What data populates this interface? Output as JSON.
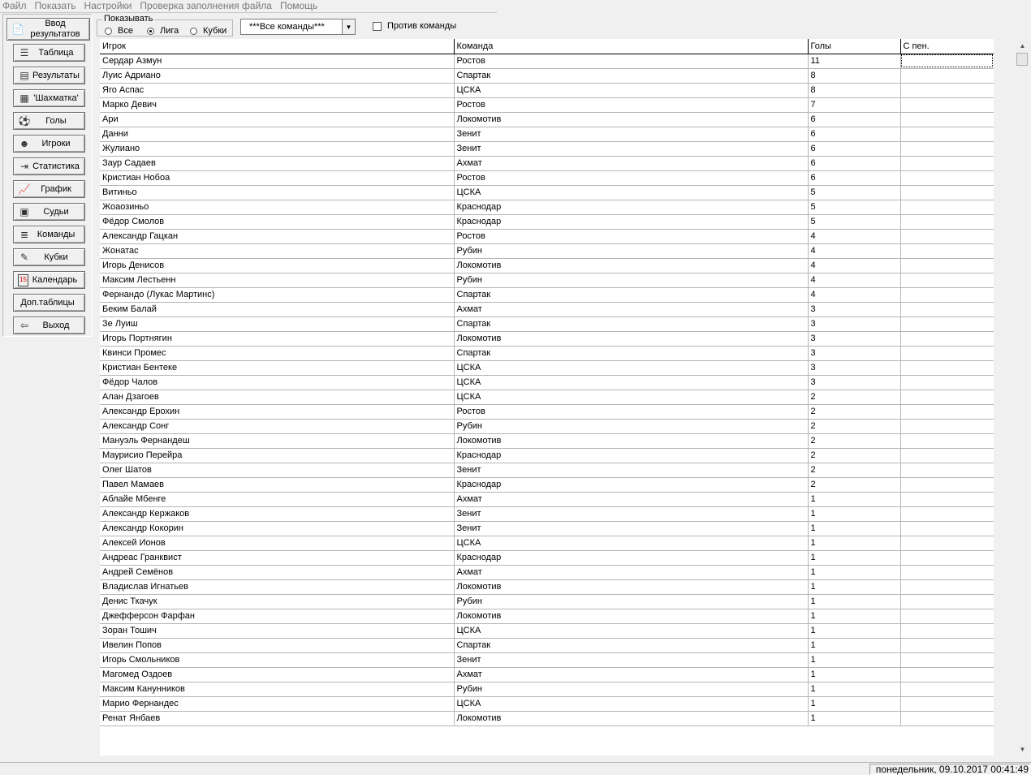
{
  "menu": [
    "Файл",
    "Показать",
    "Настройки",
    "Проверка заполнения файла",
    "Помощь"
  ],
  "nav": [
    {
      "label": "Ввод результатов",
      "icon": "📄"
    },
    {
      "label": "Таблица",
      "icon": "☰"
    },
    {
      "label": "Результаты",
      "icon": "▤"
    },
    {
      "label": "'Шахматка'",
      "icon": "▦"
    },
    {
      "label": "Голы",
      "icon": "⚽"
    },
    {
      "label": "Игроки",
      "icon": "☻"
    },
    {
      "label": "Статистика",
      "icon": "⇥"
    },
    {
      "label": "График",
      "icon": "📈"
    },
    {
      "label": "Судьи",
      "icon": "▣"
    },
    {
      "label": "Команды",
      "icon": "≣"
    },
    {
      "label": "Кубки",
      "icon": "✎"
    },
    {
      "label": "Календарь",
      "icon": "15"
    },
    {
      "label": "Доп.таблицы",
      "icon": ""
    },
    {
      "label": "Выход",
      "icon": "⇦"
    }
  ],
  "filter": {
    "legend": "Показывать",
    "options": [
      "Все",
      "Лига",
      "Кубки"
    ],
    "selected": "Лига"
  },
  "team_select": {
    "value": "***Все команды***"
  },
  "against_checkbox": {
    "label": "Против команды",
    "checked": false
  },
  "grid": {
    "columns": [
      "Игрок",
      "Команда",
      "Голы",
      "С пен."
    ],
    "rows": [
      [
        "Сердар Азмун",
        "Ростов",
        "11",
        ""
      ],
      [
        "Луис Адриано",
        "Спартак",
        "8",
        ""
      ],
      [
        "Яго Аспас",
        "ЦСКА",
        "8",
        ""
      ],
      [
        "Марко Девич",
        "Ростов",
        "7",
        ""
      ],
      [
        "Ари",
        "Локомотив",
        "6",
        ""
      ],
      [
        "Данни",
        "Зенит",
        "6",
        ""
      ],
      [
        "Жулиано",
        "Зенит",
        "6",
        ""
      ],
      [
        "Заур Садаев",
        "Ахмат",
        "6",
        ""
      ],
      [
        "Кристиан Нобоа",
        "Ростов",
        "6",
        ""
      ],
      [
        "Витиньо",
        "ЦСКА",
        "5",
        ""
      ],
      [
        "Жоаозиньо",
        "Краснодар",
        "5",
        ""
      ],
      [
        "Фёдор Смолов",
        "Краснодар",
        "5",
        ""
      ],
      [
        "Александр Гацкан",
        "Ростов",
        "4",
        ""
      ],
      [
        "Жонатас",
        "Рубин",
        "4",
        ""
      ],
      [
        "Игорь Денисов",
        "Локомотив",
        "4",
        ""
      ],
      [
        "Максим Лестьенн",
        "Рубин",
        "4",
        ""
      ],
      [
        "Фернандо (Лукас Мартинс)",
        "Спартак",
        "4",
        ""
      ],
      [
        "Беким Балай",
        "Ахмат",
        "3",
        ""
      ],
      [
        "Зе Луиш",
        "Спартак",
        "3",
        ""
      ],
      [
        "Игорь Портнягин",
        "Локомотив",
        "3",
        ""
      ],
      [
        "Квинси Промес",
        "Спартак",
        "3",
        ""
      ],
      [
        "Кристиан Бентеке",
        "ЦСКА",
        "3",
        ""
      ],
      [
        "Фёдор Чалов",
        "ЦСКА",
        "3",
        ""
      ],
      [
        "Алан Дзагоев",
        "ЦСКА",
        "2",
        ""
      ],
      [
        "Александр Ерохин",
        "Ростов",
        "2",
        ""
      ],
      [
        "Александр Сонг",
        "Рубин",
        "2",
        ""
      ],
      [
        "Мануэль Фернандеш",
        "Локомотив",
        "2",
        ""
      ],
      [
        "Маурисио Перейра",
        "Краснодар",
        "2",
        ""
      ],
      [
        "Олег Шатов",
        "Зенит",
        "2",
        ""
      ],
      [
        "Павел Мамаев",
        "Краснодар",
        "2",
        ""
      ],
      [
        "Аблайе Мбенге",
        "Ахмат",
        "1",
        ""
      ],
      [
        "Александр Кержаков",
        "Зенит",
        "1",
        ""
      ],
      [
        "Александр Кокорин",
        "Зенит",
        "1",
        ""
      ],
      [
        "Алексей Ионов",
        "ЦСКА",
        "1",
        ""
      ],
      [
        "Андреас Гранквист",
        "Краснодар",
        "1",
        ""
      ],
      [
        "Андрей Семёнов",
        "Ахмат",
        "1",
        ""
      ],
      [
        "Владислав Игнатьев",
        "Локомотив",
        "1",
        ""
      ],
      [
        "Денис Ткачук",
        "Рубин",
        "1",
        ""
      ],
      [
        "Джефферсон Фарфан",
        "Локомотив",
        "1",
        ""
      ],
      [
        "Зоран Тошич",
        "ЦСКА",
        "1",
        ""
      ],
      [
        "Ивелин Попов",
        "Спартак",
        "1",
        ""
      ],
      [
        "Игорь Смольников",
        "Зенит",
        "1",
        ""
      ],
      [
        "Магомед Оздоев",
        "Ахмат",
        "1",
        ""
      ],
      [
        "Максим Канунников",
        "Рубин",
        "1",
        ""
      ],
      [
        "Марио Фернандес",
        "ЦСКА",
        "1",
        ""
      ],
      [
        "Ренат Янбаев",
        "Локомотив",
        "1",
        ""
      ]
    ]
  },
  "status": {
    "datetime": "понедельник, 09.10.2017 00:41:49"
  }
}
